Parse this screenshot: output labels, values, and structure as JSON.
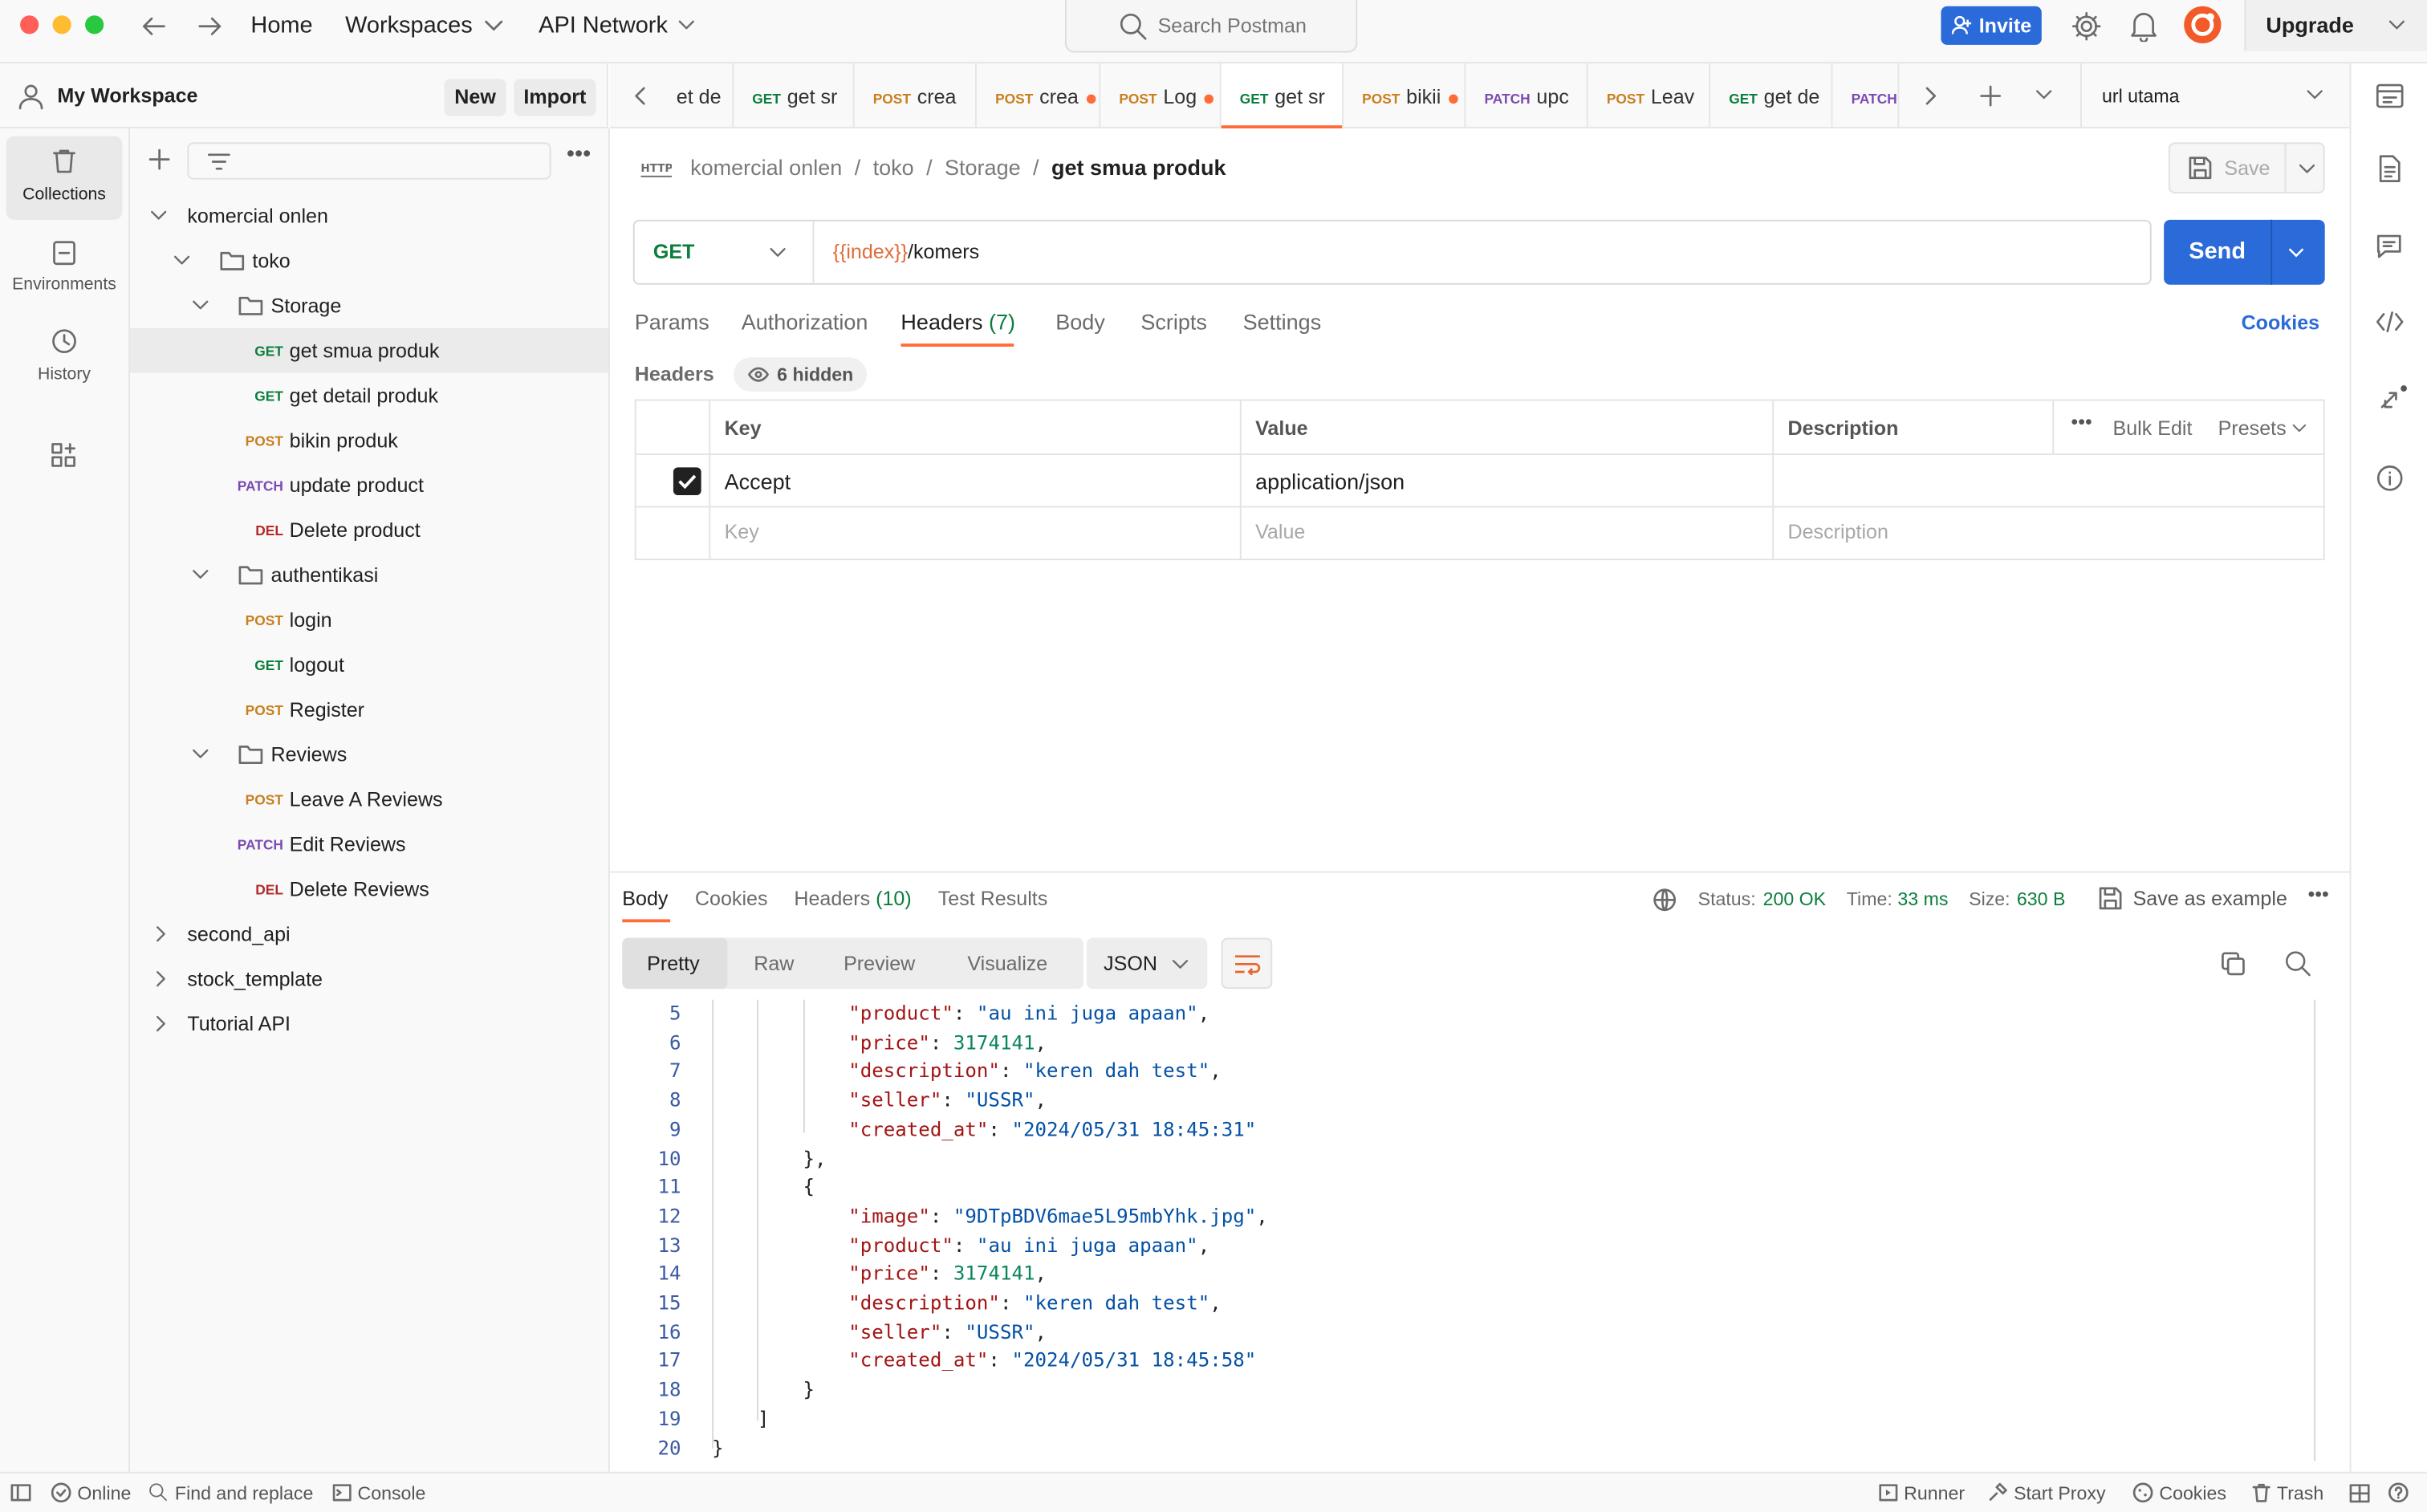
{
  "topbar": {
    "home": "Home",
    "workspaces": "Workspaces",
    "api_network": "API Network",
    "search_placeholder": "Search Postman",
    "invite": "Invite",
    "upgrade": "Upgrade"
  },
  "workspace": {
    "name": "My Workspace",
    "new_label": "New",
    "import_label": "Import"
  },
  "rail": {
    "collections": "Collections",
    "environments": "Environments",
    "history": "History"
  },
  "tree": {
    "collection": "komercial onlen",
    "toko": "toko",
    "storage": "Storage",
    "items_storage": [
      {
        "method": "GET",
        "name": "get smua produk"
      },
      {
        "method": "GET",
        "name": "get detail produk"
      }
    ],
    "items_toko": [
      {
        "method": "POST",
        "name": "bikin produk"
      },
      {
        "method": "PATCH",
        "name": "update product"
      },
      {
        "method": "DEL",
        "name": "Delete product"
      }
    ],
    "auth_folder": "authentikasi",
    "items_auth": [
      {
        "method": "POST",
        "name": "login"
      },
      {
        "method": "GET",
        "name": "logout"
      }
    ],
    "register": {
      "method": "POST",
      "name": "Register"
    },
    "reviews_folder": "Reviews",
    "items_reviews": [
      {
        "method": "POST",
        "name": "Leave A Reviews"
      },
      {
        "method": "PATCH",
        "name": "Edit Reviews"
      },
      {
        "method": "DEL",
        "name": "Delete Reviews"
      }
    ],
    "other_collections": [
      "second_api",
      "stock_template",
      "Tutorial API"
    ]
  },
  "tabs": [
    {
      "method": "",
      "name": "et de",
      "dot": false
    },
    {
      "method": "GET",
      "name": "get sr",
      "dot": false
    },
    {
      "method": "POST",
      "name": "crea",
      "dot": false
    },
    {
      "method": "POST",
      "name": "crea",
      "dot": true
    },
    {
      "method": "POST",
      "name": "Log",
      "dot": true
    },
    {
      "method": "GET",
      "name": "get sr",
      "dot": false
    },
    {
      "method": "POST",
      "name": "bikii",
      "dot": true
    },
    {
      "method": "PATCH",
      "name": "upc",
      "dot": false
    },
    {
      "method": "POST",
      "name": "Leav",
      "dot": false
    },
    {
      "method": "GET",
      "name": "get de",
      "dot": false
    },
    {
      "method": "PATCH",
      "name": "",
      "dot": false
    }
  ],
  "environment": "url utama",
  "request": {
    "breadcrumb": [
      "komercial onlen",
      "toko",
      "Storage"
    ],
    "name": "get smua produk",
    "save": "Save",
    "method": "GET",
    "url_var": "{{index}}",
    "url_path": "/komers",
    "send": "Send",
    "tabs": [
      "Params",
      "Authorization",
      "Headers",
      "Body",
      "Scripts",
      "Settings"
    ],
    "headers_count": "(7)",
    "cookies": "Cookies",
    "headers_label": "Headers",
    "hidden": "6 hidden",
    "table": {
      "key": "Key",
      "value": "Value",
      "description": "Description",
      "bulk_edit": "Bulk Edit",
      "presets": "Presets",
      "row_key": "Accept",
      "row_value": "application/json",
      "ph_key": "Key",
      "ph_value": "Value",
      "ph_desc": "Description"
    }
  },
  "response": {
    "tabs": [
      "Body",
      "Cookies",
      "Headers",
      "Test Results"
    ],
    "headers_count": "(10)",
    "status_label": "Status:",
    "status": "200 OK",
    "time_label": "Time:",
    "time": "33 ms",
    "size_label": "Size:",
    "size": "630 B",
    "save_example": "Save as example",
    "views": [
      "Pretty",
      "Raw",
      "Preview",
      "Visualize"
    ],
    "format": "JSON",
    "lines": [
      {
        "n": "5",
        "indent": 6,
        "k": "product",
        "v": "\"au ini juga apaan\"",
        "t": "s",
        "c": ","
      },
      {
        "n": "6",
        "indent": 6,
        "k": "price",
        "v": "3174141",
        "t": "n",
        "c": ","
      },
      {
        "n": "7",
        "indent": 6,
        "k": "description",
        "v": "\"keren dah test\"",
        "t": "s",
        "c": ","
      },
      {
        "n": "8",
        "indent": 6,
        "k": "seller",
        "v": "\"USSR\"",
        "t": "s",
        "c": ","
      },
      {
        "n": "9",
        "indent": 6,
        "k": "created_at",
        "v": "\"2024/05/31 18:45:31\"",
        "t": "s",
        "c": ""
      },
      {
        "n": "10",
        "indent": 4,
        "raw": "},"
      },
      {
        "n": "11",
        "indent": 4,
        "raw": "{"
      },
      {
        "n": "12",
        "indent": 6,
        "k": "image",
        "v": "\"9DTpBDV6mae5L95mbYhk.jpg\"",
        "t": "s",
        "c": ","
      },
      {
        "n": "13",
        "indent": 6,
        "k": "product",
        "v": "\"au ini juga apaan\"",
        "t": "s",
        "c": ","
      },
      {
        "n": "14",
        "indent": 6,
        "k": "price",
        "v": "3174141",
        "t": "n",
        "c": ","
      },
      {
        "n": "15",
        "indent": 6,
        "k": "description",
        "v": "\"keren dah test\"",
        "t": "s",
        "c": ","
      },
      {
        "n": "16",
        "indent": 6,
        "k": "seller",
        "v": "\"USSR\"",
        "t": "s",
        "c": ","
      },
      {
        "n": "17",
        "indent": 6,
        "k": "created_at",
        "v": "\"2024/05/31 18:45:58\"",
        "t": "s",
        "c": ""
      },
      {
        "n": "18",
        "indent": 4,
        "raw": "}"
      },
      {
        "n": "19",
        "indent": 2,
        "raw": "]"
      },
      {
        "n": "20",
        "indent": 0,
        "raw": "}"
      }
    ]
  },
  "statusbar": {
    "online": "Online",
    "find": "Find and replace",
    "console": "Console",
    "runner": "Runner",
    "proxy": "Start Proxy",
    "cookies": "Cookies",
    "trash": "Trash"
  },
  "colors": {
    "accent": "#ff6c37",
    "primary": "#2b6ad9",
    "get": "#0b7e3b",
    "post": "#c97f1d",
    "patch": "#7b4ab3",
    "delete": "#b32a2a",
    "status_ok": "#0b7e3b"
  }
}
